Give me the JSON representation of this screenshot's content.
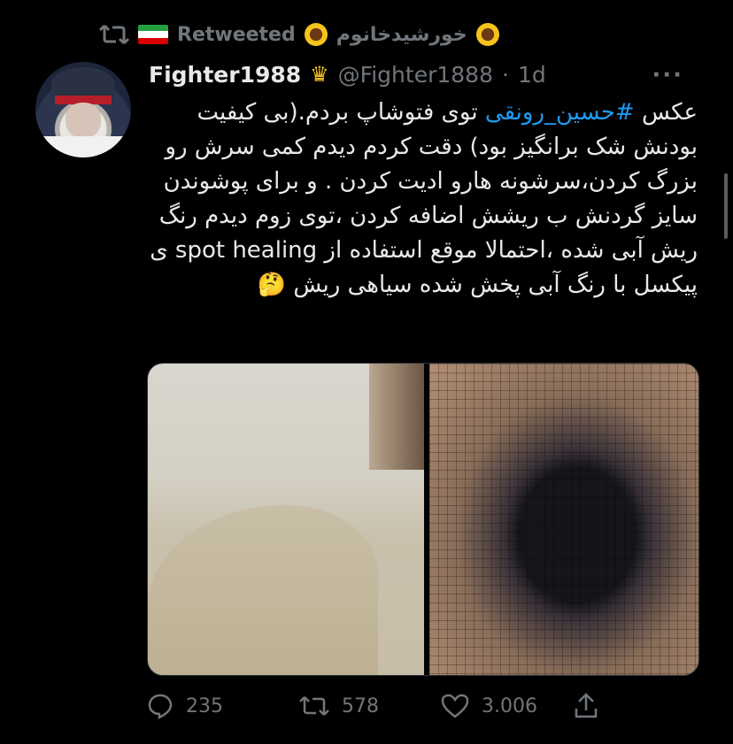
{
  "retweet": {
    "label": "Retweeted",
    "user_name": "خورشیدخانوم"
  },
  "tweet": {
    "display_name": "Fighter1988",
    "handle": "@Fighter1888",
    "separator": "·",
    "time": "1d",
    "text_part1": "عکس ",
    "hashtag": "#حسین_رونقی",
    "text_part2": " توی فتوشاپ بردم.(بی کیفیت بودنش شک برانگیز بود) دقت کردم دیدم کمی سرش رو بزرگ کردن،سرشونه هارو ادیت کردن . و برای پوشوندن سایز گردنش ب ریشش اضافه کردن ،توی زوم دیدم رنگ ریش آبی شده ،احتمالا موقع استفاده از spot healing ی پیکسل با رنگ آبی پخش شده سیاهی ریش",
    "emoji": "🤔"
  },
  "actions": {
    "replies": "235",
    "retweets": "578",
    "likes": "3.006"
  },
  "icons": {
    "retweet": "retweet-icon",
    "flag": "iran-flag-icon",
    "sunflower": "sunflower-icon",
    "crown": "crown-icon",
    "more": "more-icon",
    "reply": "reply-icon",
    "like": "heart-icon",
    "share": "share-icon"
  },
  "colors": {
    "background": "#000000",
    "text": "#e7e9ea",
    "muted": "#71767b",
    "link": "#1d9bf0"
  }
}
